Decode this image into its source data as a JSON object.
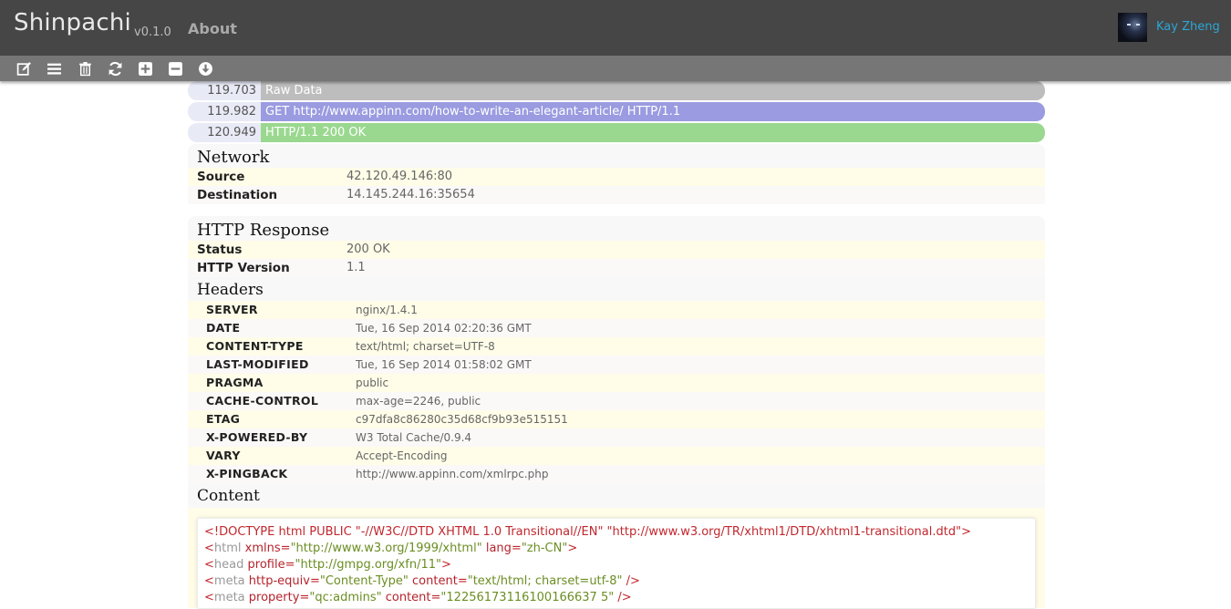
{
  "navbar": {
    "brand": "Shinpachi",
    "version": "v0.1.0",
    "about": "About",
    "username": "Kay Zheng"
  },
  "toolbar": {
    "buttons": [
      {
        "name": "edit",
        "icon": "edit-icon"
      },
      {
        "name": "list",
        "icon": "list-icon"
      },
      {
        "name": "delete",
        "icon": "trash-icon"
      },
      {
        "name": "refresh",
        "icon": "refresh-icon"
      },
      {
        "name": "expand",
        "icon": "plus-square-icon"
      },
      {
        "name": "collapse",
        "icon": "minus-square-icon"
      },
      {
        "name": "scroll-bottom",
        "icon": "arrow-down-circle-icon"
      }
    ]
  },
  "packets": [
    {
      "time": "119.703",
      "label": "Raw Data",
      "color": "#bdbdbd"
    },
    {
      "time": "119.982",
      "label": "GET http://www.appinn.com/how-to-write-an-elegant-article/ HTTP/1.1",
      "color": "#9a9be0"
    },
    {
      "time": "120.949",
      "label": "HTTP/1.1 200 OK",
      "color": "#9ad88f"
    }
  ],
  "network": {
    "title": "Network",
    "rows": [
      {
        "key": "Source",
        "value": "42.120.49.146:80"
      },
      {
        "key": "Destination",
        "value": "14.145.244.16:35654"
      }
    ]
  },
  "http_response": {
    "title": "HTTP Response",
    "rows": [
      {
        "key": "Status",
        "value": "200 OK"
      },
      {
        "key": "HTTP Version",
        "value": "1.1"
      }
    ],
    "headers_title": "Headers",
    "headers": [
      {
        "key": "SERVER",
        "value": "nginx/1.4.1"
      },
      {
        "key": "DATE",
        "value": "Tue, 16 Sep 2014 02:20:36 GMT"
      },
      {
        "key": "CONTENT-TYPE",
        "value": "text/html; charset=UTF-8"
      },
      {
        "key": "LAST-MODIFIED",
        "value": "Tue, 16 Sep 2014 01:58:02 GMT"
      },
      {
        "key": "PRAGMA",
        "value": "public"
      },
      {
        "key": "CACHE-CONTROL",
        "value": "max-age=2246, public"
      },
      {
        "key": "ETAG",
        "value": "c97dfa8c86280c35d68cf9b93e515151"
      },
      {
        "key": "X-POWERED-BY",
        "value": "W3 Total Cache/0.9.4"
      },
      {
        "key": "VARY",
        "value": "Accept-Encoding"
      },
      {
        "key": "X-PINGBACK",
        "value": "http://www.appinn.com/xmlrpc.php"
      }
    ],
    "content_title": "Content",
    "content": {
      "doctype": "<!DOCTYPE html PUBLIC \"-//W3C//DTD XHTML 1.0 Transitional//EN\" \"http://www.w3.org/TR/xhtml1/DTD/xhtml1-transitional.dtd\">",
      "line2": {
        "open": "<",
        "tag": "html",
        "attrs": [
          {
            "n": "xmlns",
            "v": "\"http://www.w3.org/1999/xhtml\""
          },
          {
            "n": "lang",
            "v": "\"zh-CN\""
          }
        ],
        "close": ">"
      },
      "line3": {
        "open": "<",
        "tag": "head",
        "attrs": [
          {
            "n": "profile",
            "v": "\"http://gmpg.org/xfn/11\""
          }
        ],
        "close": ">"
      },
      "line4": {
        "open": "<",
        "tag": "meta",
        "attrs": [
          {
            "n": "http-equiv",
            "v": "\"Content-Type\""
          },
          {
            "n": "content",
            "v": "\"text/html; charset=utf-8\""
          }
        ],
        "close": " />"
      },
      "line5": {
        "open": "<",
        "tag": "meta",
        "attrs": [
          {
            "n": "property",
            "v": "\"qc:admins\""
          },
          {
            "n": "content",
            "v": "\"12256173116100166637 5\""
          }
        ],
        "close": " />"
      }
    }
  }
}
